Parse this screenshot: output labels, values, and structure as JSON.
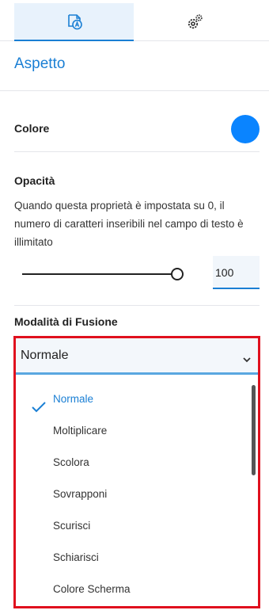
{
  "tabs": [
    {
      "icon": "text-style-icon",
      "active": true
    },
    {
      "icon": "gears-icon",
      "active": false
    }
  ],
  "section_title": "Aspetto",
  "color": {
    "label": "Colore",
    "value": "#0a84ff"
  },
  "opacity": {
    "label": "Opacità",
    "description": "Quando questa proprietà è impostata su 0, il numero di caratteri inseribili nel campo di testo è illimitato",
    "value": "100",
    "slider_fraction": 1.0
  },
  "blend_mode": {
    "label": "Modalità di Fusione",
    "selected": "Normale",
    "options": [
      "Normale",
      "Moltiplicare",
      "Scolora",
      "Sovrapponi",
      "Scurisci",
      "Schiarisci",
      "Colore Scherma"
    ]
  },
  "colors": {
    "accent": "#1a7fd4",
    "highlight": "#e0101e",
    "swatch": "#0a84ff"
  }
}
